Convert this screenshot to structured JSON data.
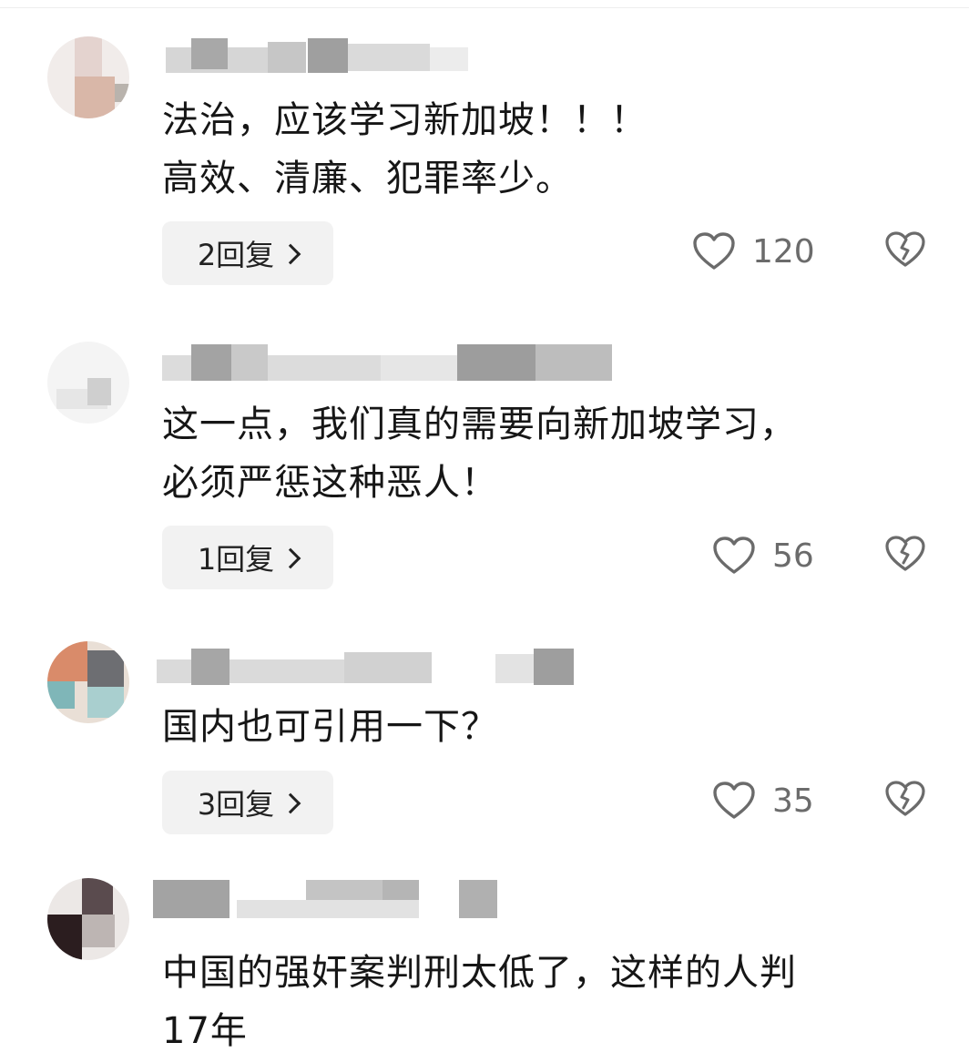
{
  "comments": [
    {
      "text": "法治，应该学习新加坡！！！\n高效、清廉、犯罪率少。",
      "replies_label": "2回复",
      "likes": "120"
    },
    {
      "text": "这一点，我们真的需要向新加坡学习，\n必须严惩这种恶人！",
      "replies_label": "1回复",
      "likes": "56"
    },
    {
      "text": "国内也可引用一下？",
      "replies_label": "3回复",
      "likes": "35"
    },
    {
      "text": "中国的强奸案判刑太低了，这样的人判\n17年"
    }
  ],
  "icons": {
    "like": "heart-outline-icon",
    "dislike": "broken-heart-icon",
    "reply_chevron": "chevron-right-icon"
  },
  "colors": {
    "text": "#161616",
    "count": "#6b6b6b",
    "reply_bg": "#f2f2f2",
    "icon": "#6b6b6b"
  }
}
